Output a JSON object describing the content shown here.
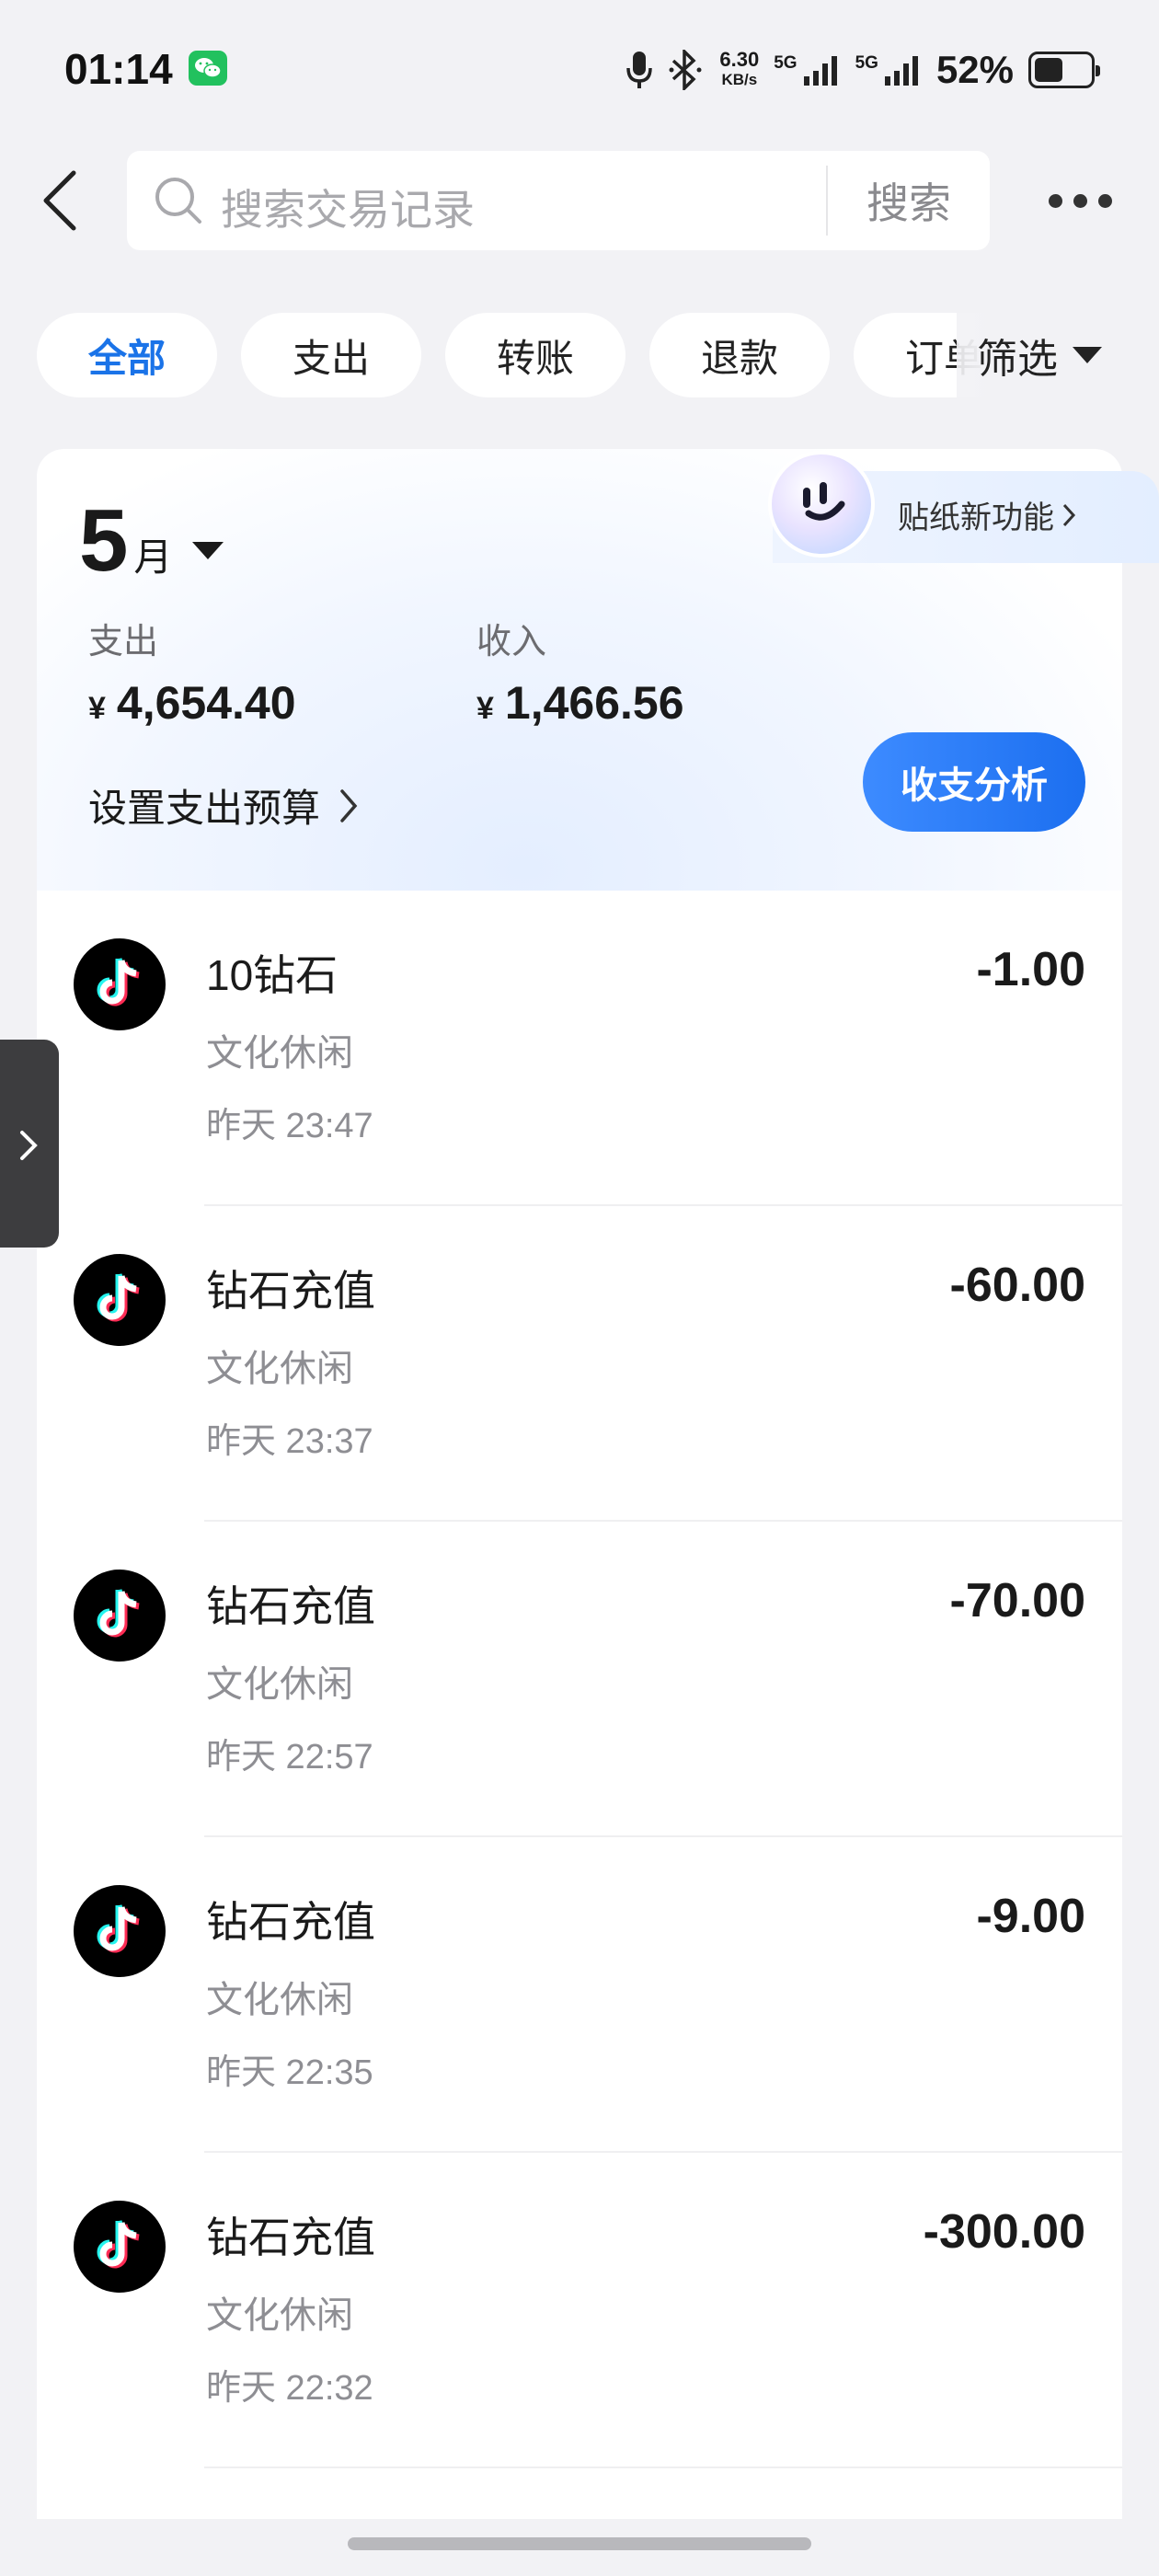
{
  "status_bar": {
    "time": "01:14",
    "net_speed": "6.30",
    "net_unit": "KB/s",
    "sim1": "5G",
    "sim2": "5G",
    "battery_pct": "52%",
    "battery_level": 0.52
  },
  "header": {
    "search_placeholder": "搜索交易记录",
    "search_button": "搜索"
  },
  "filters": {
    "chips": [
      "全部",
      "支出",
      "转账",
      "退款",
      "订单"
    ],
    "active_index": 0,
    "filter_label": "筛选"
  },
  "summary": {
    "month": "5",
    "month_unit": "月",
    "sticker_label": "贴纸新功能",
    "expense_label": "支出",
    "expense_value": "4,654.40",
    "income_label": "收入",
    "income_value": "1,466.56",
    "currency": "¥",
    "budget_link": "设置支出预算",
    "analysis_button": "收支分析"
  },
  "transactions": [
    {
      "title": "10钻石",
      "category": "文化休闲",
      "time": "昨天 23:47",
      "amount": "-1.00"
    },
    {
      "title": "钻石充值",
      "category": "文化休闲",
      "time": "昨天 23:37",
      "amount": "-60.00"
    },
    {
      "title": "钻石充值",
      "category": "文化休闲",
      "time": "昨天 22:57",
      "amount": "-70.00"
    },
    {
      "title": "钻石充值",
      "category": "文化休闲",
      "time": "昨天 22:35",
      "amount": "-9.00"
    },
    {
      "title": "钻石充值",
      "category": "文化休闲",
      "time": "昨天 22:32",
      "amount": "-300.00"
    }
  ],
  "colors": {
    "accent": "#1a73e8",
    "button_blue": "#2277f2",
    "background": "#f2f2f5",
    "wechat_green": "#22c15e"
  },
  "icons": {
    "back": "chevron-left-icon",
    "search": "search-icon",
    "more": "more-dots-icon",
    "filter": "triangle-down-icon",
    "merchant": "tiktok-logo-icon",
    "drawer": "chevron-right-icon"
  }
}
